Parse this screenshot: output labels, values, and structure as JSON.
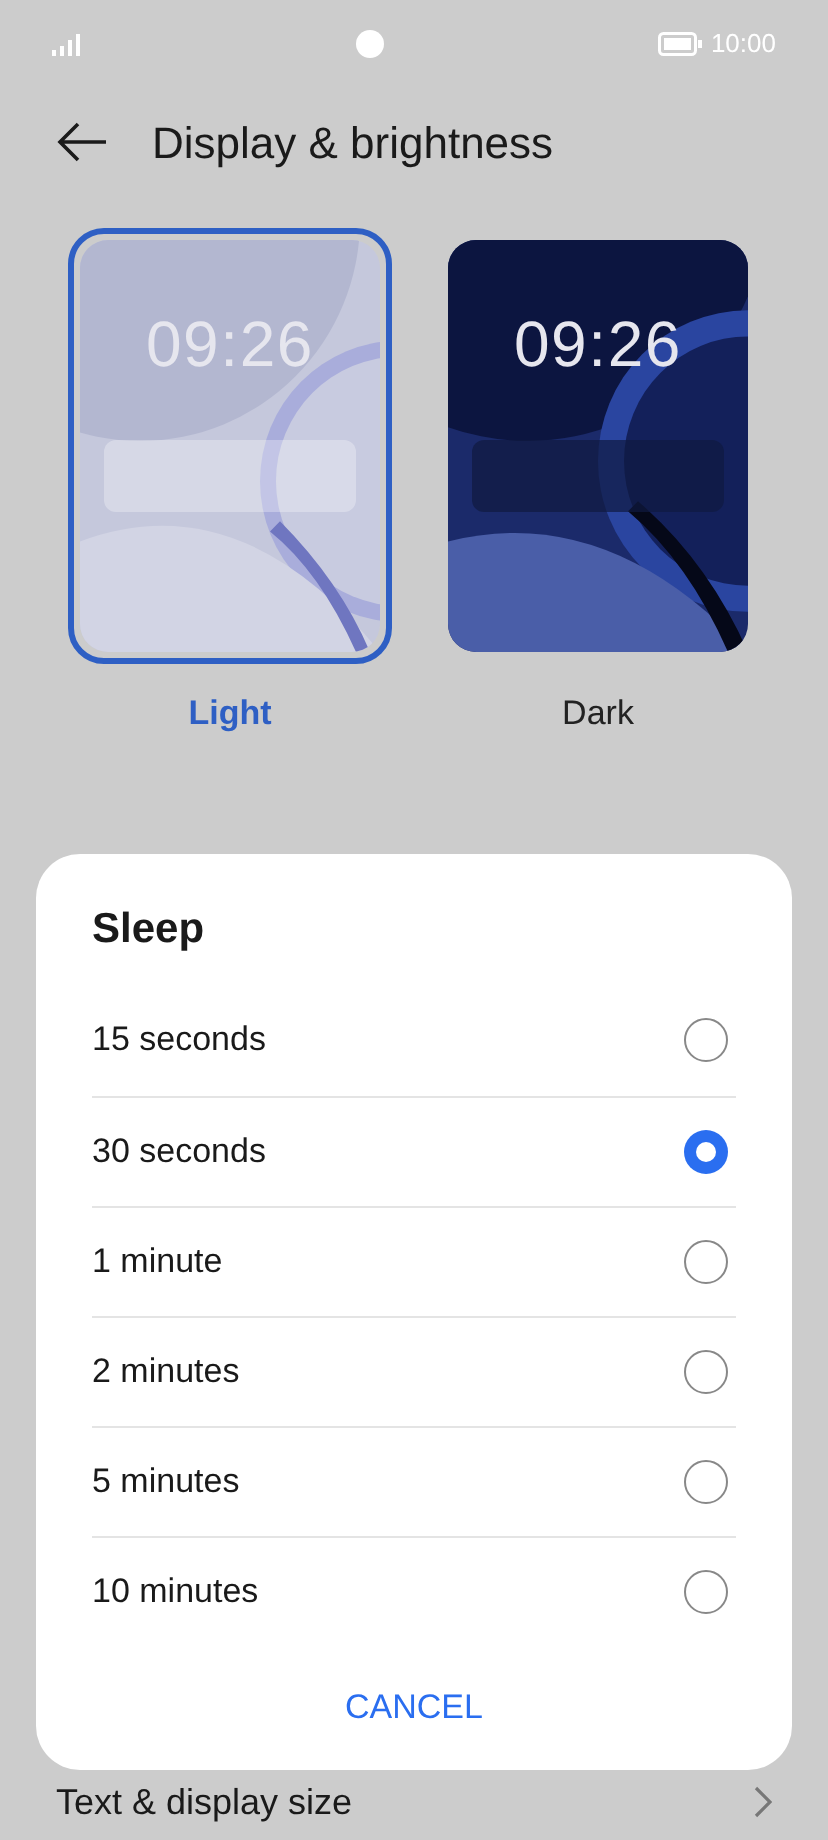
{
  "status_bar": {
    "time": "10:00"
  },
  "header": {
    "title": "Display & brightness"
  },
  "themes": [
    {
      "label": "Light",
      "clock": "09:26",
      "kind": "light",
      "selected": true
    },
    {
      "label": "Dark",
      "clock": "09:26",
      "kind": "dark",
      "selected": false
    }
  ],
  "settings_row": {
    "label": "Text & display size"
  },
  "dialog": {
    "title": "Sleep",
    "options": [
      {
        "label": "15 seconds",
        "selected": false
      },
      {
        "label": "30 seconds",
        "selected": true
      },
      {
        "label": "1 minute",
        "selected": false
      },
      {
        "label": "2 minutes",
        "selected": false
      },
      {
        "label": "5 minutes",
        "selected": false
      },
      {
        "label": "10 minutes",
        "selected": false
      }
    ],
    "cancel": "CANCEL"
  }
}
